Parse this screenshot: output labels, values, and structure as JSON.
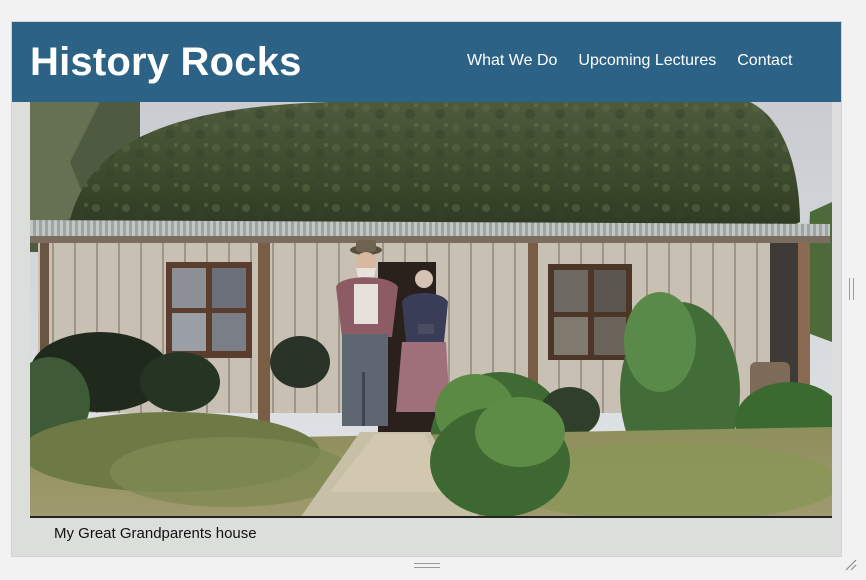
{
  "header": {
    "title": "History Rocks",
    "nav": [
      "What We Do",
      "Upcoming Lectures",
      "Contact"
    ]
  },
  "photo": {
    "caption": "My Great Grandparents house"
  },
  "colors": {
    "header_bg": "#2b6285",
    "frame_bg": "#dcdedb",
    "header_text": "#ffffff"
  }
}
